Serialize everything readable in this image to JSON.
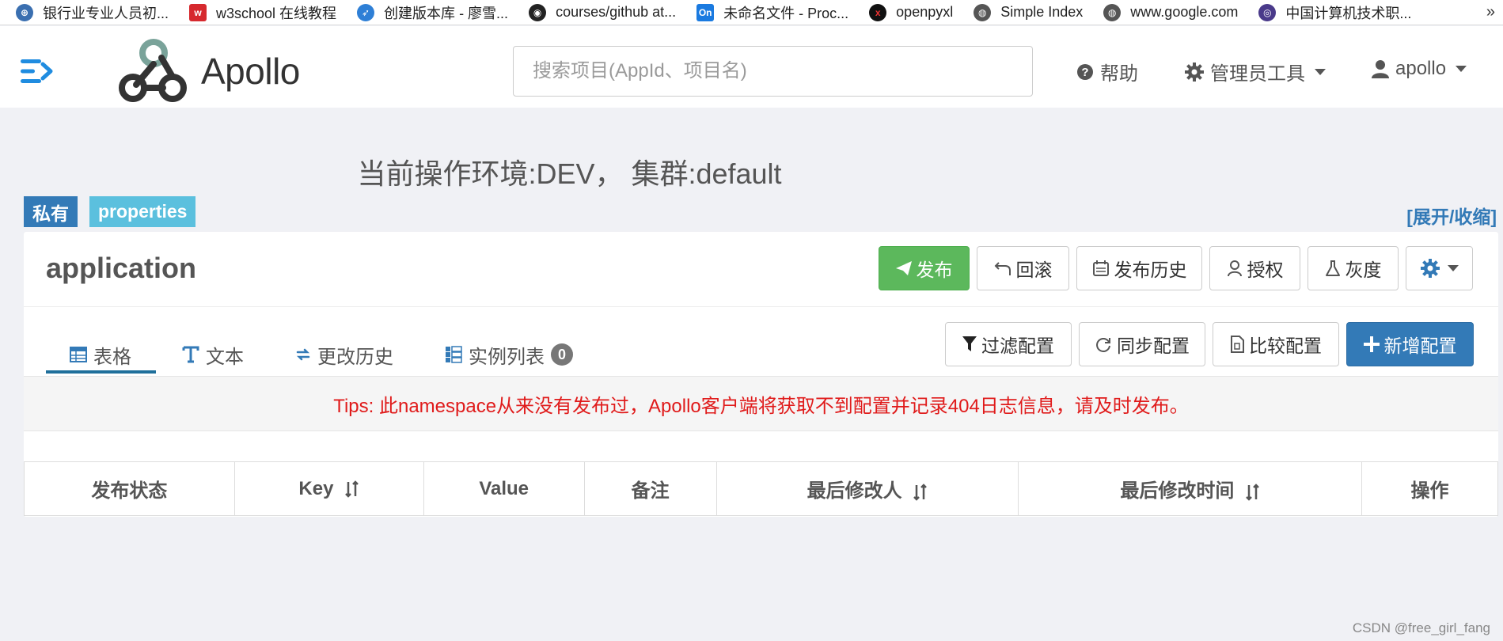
{
  "bookmarks": [
    {
      "label": "银行业专业人员初...",
      "icon": "bank-icon",
      "color": "#3a6fb0"
    },
    {
      "label": "w3school 在线教程",
      "icon": "w3school-icon",
      "color": "#d6292e"
    },
    {
      "label": "创建版本库 - 廖雪...",
      "icon": "rocket-icon",
      "color": "#2e7fd6"
    },
    {
      "label": "courses/github at...",
      "icon": "github-icon",
      "color": "#222222"
    },
    {
      "label": "未命名文件 - Proc...",
      "icon": "processon-icon",
      "color": "#1a7ae0"
    },
    {
      "label": "openpyxl",
      "icon": "openpyxl-icon",
      "color": "#111111"
    },
    {
      "label": "Simple Index",
      "icon": "globe-icon",
      "color": "#555555"
    },
    {
      "label": "www.google.com",
      "icon": "globe-icon",
      "color": "#555555"
    },
    {
      "label": "中国计算机技术职...",
      "icon": "ccf-icon",
      "color": "#4a3a8a"
    }
  ],
  "bookmarks_more": "»",
  "navbar": {
    "logo_text": "Apollo",
    "search_placeholder": "搜索项目(AppId、项目名)",
    "help_label": "帮助",
    "admin_label": "管理员工具",
    "user_label": "apollo"
  },
  "env_title": "当前操作环境:DEV， 集群:default",
  "labels": {
    "private": "私有",
    "format": "properties",
    "expand": "[展开/收缩]"
  },
  "namespace": {
    "name": "application",
    "buttons": {
      "publish": "发布",
      "rollback": "回滚",
      "history": "发布历史",
      "auth": "授权",
      "gray": "灰度"
    }
  },
  "tabs": {
    "table": "表格",
    "text": "文本",
    "history": "更改历史",
    "instances": "实例列表",
    "instances_count": "0"
  },
  "actions": {
    "filter": "过滤配置",
    "sync": "同步配置",
    "compare": "比较配置",
    "add": "新增配置"
  },
  "tips": "Tips: 此namespace从来没有发布过，Apollo客户端将获取不到配置并记录404日志信息，请及时发布。",
  "table": {
    "headers": [
      "发布状态",
      "Key",
      "Value",
      "备注",
      "最后修改人",
      "最后修改时间",
      "操作"
    ]
  },
  "watermark": "CSDN @free_girl_fang",
  "colors": {
    "primary": "#337ab7",
    "success": "#5cb85c",
    "info": "#5bc0de",
    "tips_red": "#e01b1b",
    "page_bg": "#f0f1f5"
  }
}
